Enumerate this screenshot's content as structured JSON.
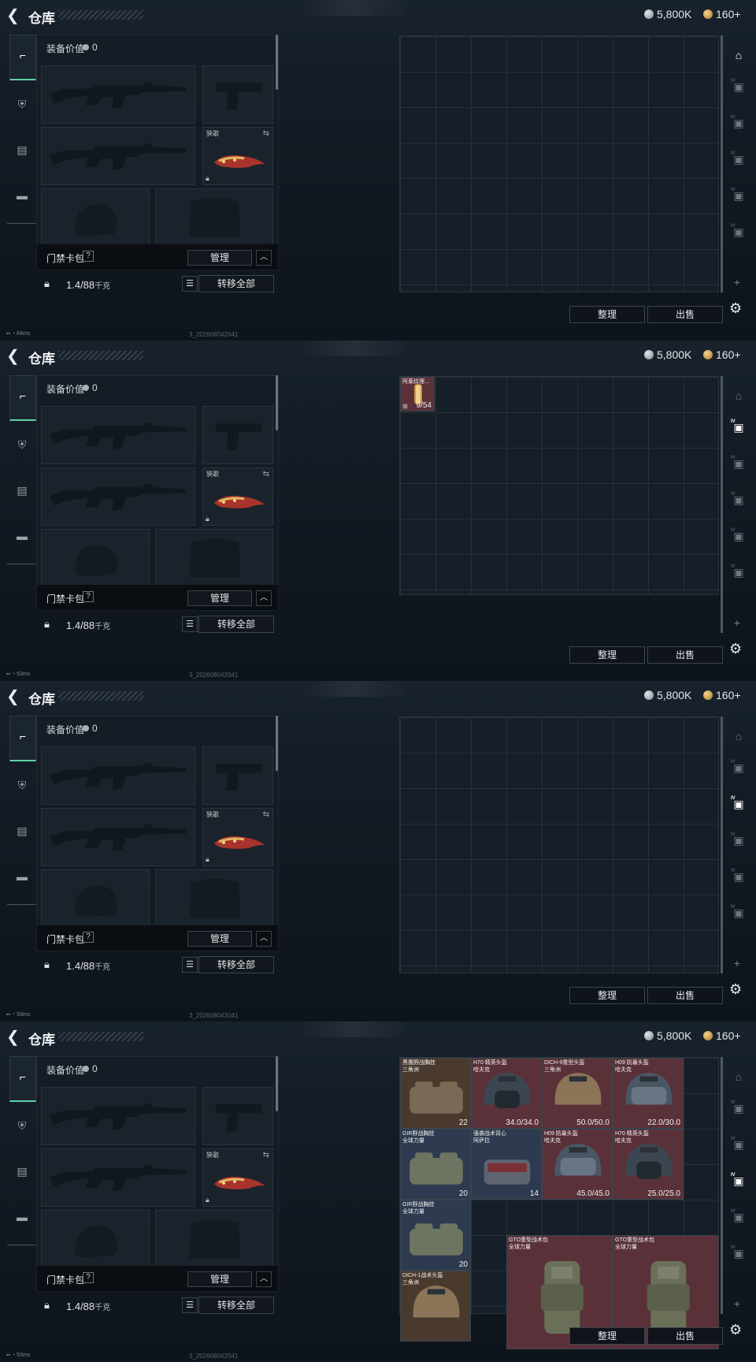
{
  "header": {
    "title": "仓库",
    "silver": "5,800K",
    "gold": "160+"
  },
  "equip": {
    "value_label": "装备价值",
    "value": "0",
    "melee_label": "狭歌",
    "rig_label": "胸挂",
    "bag_label": "门禁卡包",
    "bag_help": "?",
    "manage": "管理",
    "weight": "1.4/88",
    "weight_unit": "千克",
    "transfer": "转移全部"
  },
  "actions": {
    "sort": "整理",
    "sell": "出售",
    "plus": "+"
  },
  "panels": [
    {
      "latency": "64ms",
      "build": "3_202608042041",
      "active_tab": 0
    },
    {
      "latency": "53ms",
      "build": "3_202608042041",
      "active_tab": 1
    },
    {
      "latency": "53ms",
      "build": "3_202608042041",
      "active_tab": 2
    },
    {
      "latency": "53ms",
      "build": "3_202608042041",
      "active_tab": 3
    }
  ],
  "right_tabs": [
    "main-storage",
    "IV",
    "IV",
    "IV",
    "IV",
    "IV"
  ],
  "panel2_item": {
    "name": "阿莱纹理…",
    "count": "9/54"
  },
  "panel4_items": [
    {
      "name": "黑鹰野战胸挂",
      "sub": "三角洲",
      "count": "22",
      "kind": "rig",
      "color": "#4a3a2e"
    },
    {
      "name": "H70 精英头盔",
      "sub": "哈夫克",
      "count": "34.0/34.0",
      "kind": "helmet-dark",
      "color": "#5a3139"
    },
    {
      "name": "DICH-9重型头盔",
      "sub": "三角洲",
      "count": "50.0/50.0",
      "kind": "helmet-tan",
      "color": "#5a3139"
    },
    {
      "name": "H09 防暴头盔",
      "sub": "哈夫克",
      "count": "22.0/30.0",
      "kind": "helmet-visor",
      "color": "#5a3139"
    },
    {
      "name": "GIR野战胸挂",
      "sub": "全球力量",
      "count": "20",
      "kind": "rig-green",
      "color": "#2e3a4f"
    },
    {
      "name": "强袭战术背心",
      "sub": "阿萨拉",
      "count": "14",
      "kind": "vest",
      "color": "#2e3a4f"
    },
    {
      "name": "H09 防暴头盔",
      "sub": "哈夫克",
      "count": "45.0/45.0",
      "kind": "helmet-visor",
      "color": "#5a3139"
    },
    {
      "name": "H70 精英头盔",
      "sub": "哈夫克",
      "count": "25.0/25.0",
      "kind": "helmet-dark",
      "color": "#5a3139"
    },
    {
      "name": "GIR野战胸挂",
      "sub": "全球力量",
      "count": "20",
      "kind": "rig-green",
      "color": "#2e3a4f"
    },
    {
      "name": "GTO重型战术包",
      "sub": "全球力量",
      "count": "",
      "kind": "backpack",
      "color": "#5a3139"
    },
    {
      "name": "GTO重型战术包",
      "sub": "全球力量",
      "count": "",
      "kind": "backpack",
      "color": "#5a3139"
    },
    {
      "name": "DICH-1战术头盔",
      "sub": "三角洲",
      "count": "",
      "kind": "helmet-tan",
      "color": "#4a3a2e"
    }
  ]
}
